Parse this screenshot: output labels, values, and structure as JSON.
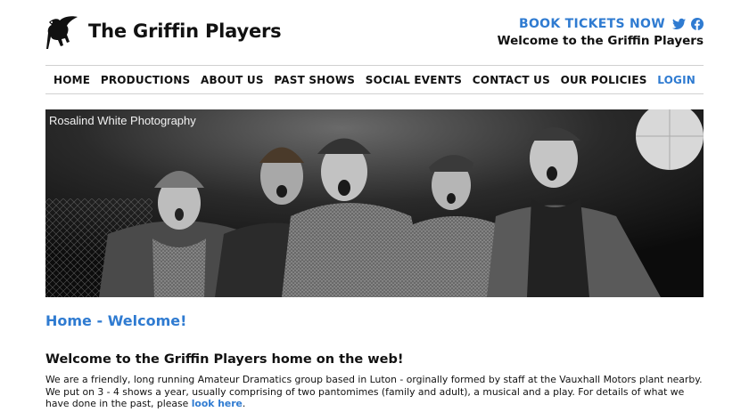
{
  "site": {
    "logo_icon": "griffin-icon",
    "name": "The Griffin Players"
  },
  "header": {
    "book_tickets": "BOOK TICKETS NOW",
    "social_icons": [
      "twitter-icon",
      "facebook-icon"
    ],
    "welcome": "Welcome to the Griffin Players"
  },
  "nav": {
    "items": [
      {
        "label": "HOME"
      },
      {
        "label": "PRODUCTIONS"
      },
      {
        "label": "ABOUT US"
      },
      {
        "label": "PAST SHOWS"
      },
      {
        "label": "SOCIAL EVENTS"
      },
      {
        "label": "CONTACT US"
      },
      {
        "label": "OUR POLICIES"
      },
      {
        "label": "LOGIN"
      }
    ]
  },
  "hero": {
    "credit": "Rosalind White Photography"
  },
  "main": {
    "heading": "Home - Welcome!",
    "subheading": "Welcome to the Griffin Players home on the web!",
    "intro_text": "We are a friendly, long running Amateur Dramatics group based in Luton - orginally formed by staff at the Vauxhall Motors plant nearby. We put on 3 - 4 shows a year, usually comprising of two pantomimes (family and adult), a musical and a play. For details of what we have done in the past, please ",
    "intro_link": "look here",
    "intro_end": "."
  },
  "colors": {
    "accent": "#2f7bd1",
    "text": "#111111",
    "border": "#d0d0d0"
  }
}
